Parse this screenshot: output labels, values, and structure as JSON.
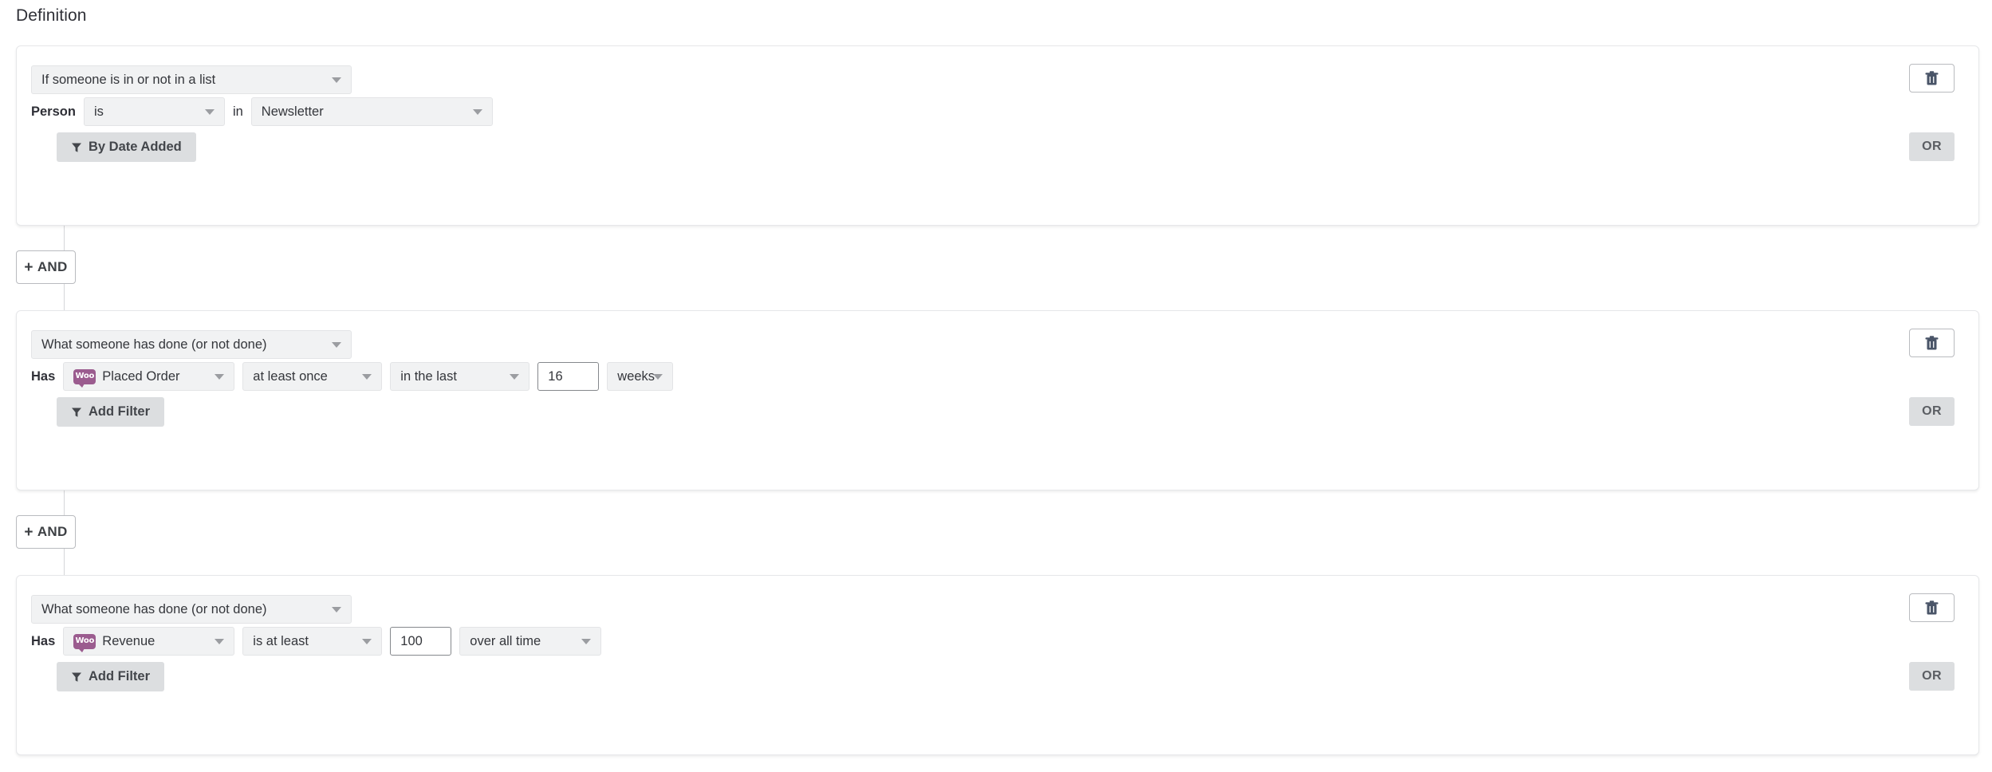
{
  "section": {
    "title": "Definition"
  },
  "icons": {
    "trash": "trash-icon",
    "funnel": "filter-funnel-icon",
    "caret": "chevron-down-icon",
    "woo": "woocommerce-icon",
    "woo_text": "Woo"
  },
  "colors": {
    "woo_purple": "#9b5c8f",
    "trash_icon": "#4a5568",
    "button_grey": "#dcdee0",
    "select_grey": "#f1f2f3",
    "card_border": "#e6e7e9"
  },
  "connector_buttons": [
    {
      "label": "AND",
      "plus": "+"
    },
    {
      "label": "AND",
      "plus": "+"
    }
  ],
  "blocks": [
    {
      "type_select": "If someone is in or not in a list",
      "prefix_label": "Person",
      "operator_select": "is",
      "middle_label": "in",
      "list_select": "Newsletter",
      "filter_button": "By Date Added",
      "or_button": "OR",
      "delete_button": ""
    },
    {
      "type_select": "What someone has done (or not done)",
      "prefix_label": "Has",
      "metric_select": "Placed Order",
      "metric_icon": "woocommerce-icon",
      "frequency_select": "at least once",
      "timeframe_select": "in the last",
      "amount_value": "16",
      "unit_select": "weeks",
      "filter_button": "Add Filter",
      "or_button": "OR",
      "delete_button": ""
    },
    {
      "type_select": "What someone has done (or not done)",
      "prefix_label": "Has",
      "metric_select": "Revenue",
      "metric_icon": "woocommerce-icon",
      "frequency_select": "is at least",
      "amount_value": "100",
      "timeframe_select": "over all time",
      "filter_button": "Add Filter",
      "or_button": "OR",
      "delete_button": ""
    }
  ]
}
